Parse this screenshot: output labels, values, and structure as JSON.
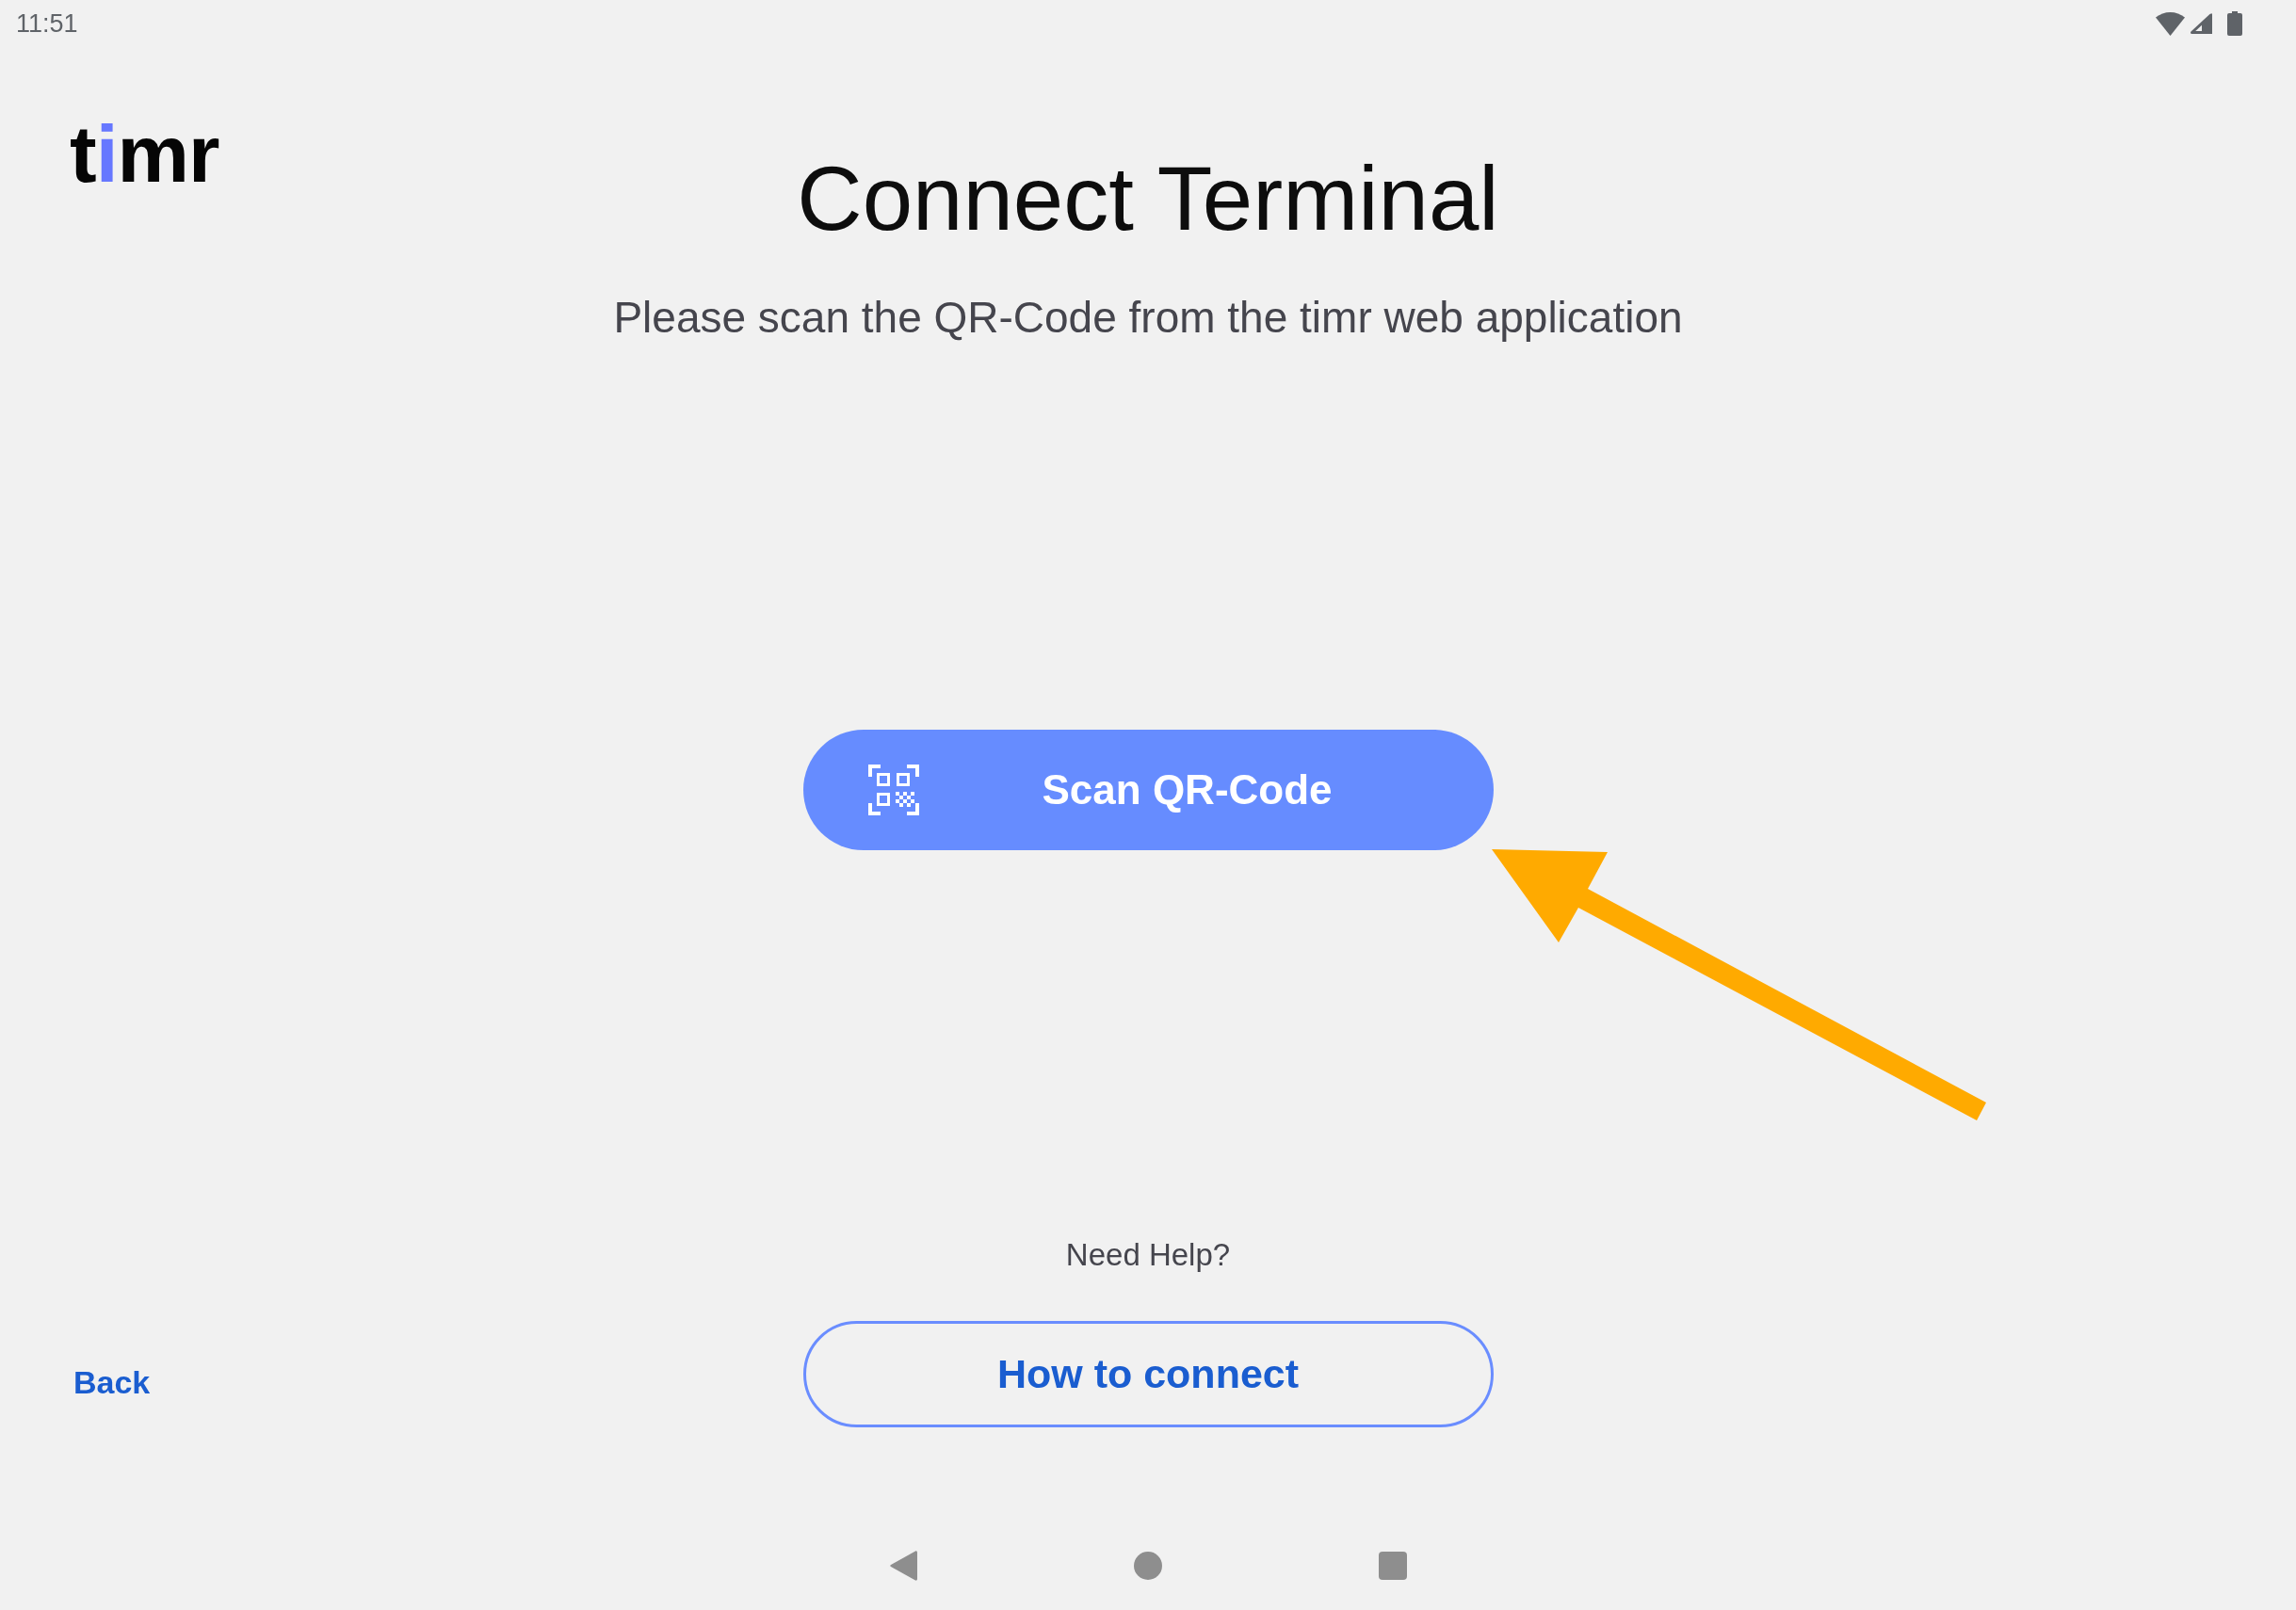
{
  "status_bar": {
    "time": "11:51"
  },
  "logo": "timr",
  "title": "Connect Terminal",
  "subtitle": "Please scan the QR-Code from the timr web application",
  "scan_button": {
    "label": "Scan QR-Code"
  },
  "help": {
    "prompt": "Need Help?",
    "button": "How to connect"
  },
  "back_link": "Back"
}
